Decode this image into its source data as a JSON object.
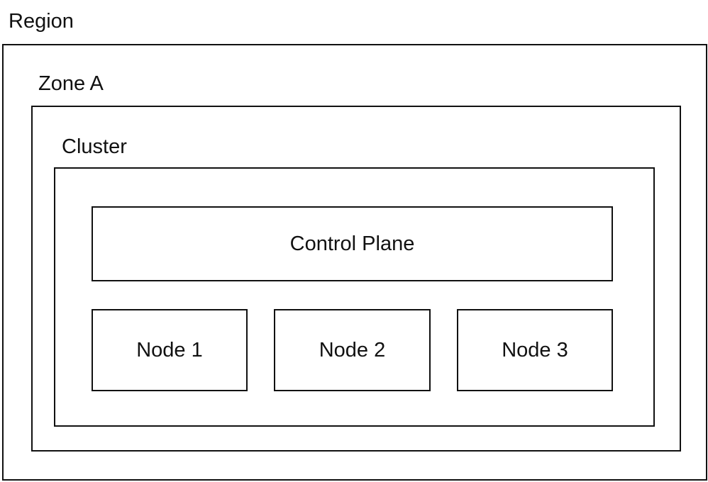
{
  "diagram": {
    "region": {
      "label": "Region"
    },
    "zone": {
      "label": "Zone A"
    },
    "cluster": {
      "label": "Cluster"
    },
    "control_plane": {
      "label": "Control Plane"
    },
    "nodes": [
      {
        "label": "Node 1"
      },
      {
        "label": "Node 2"
      },
      {
        "label": "Node 3"
      }
    ]
  }
}
